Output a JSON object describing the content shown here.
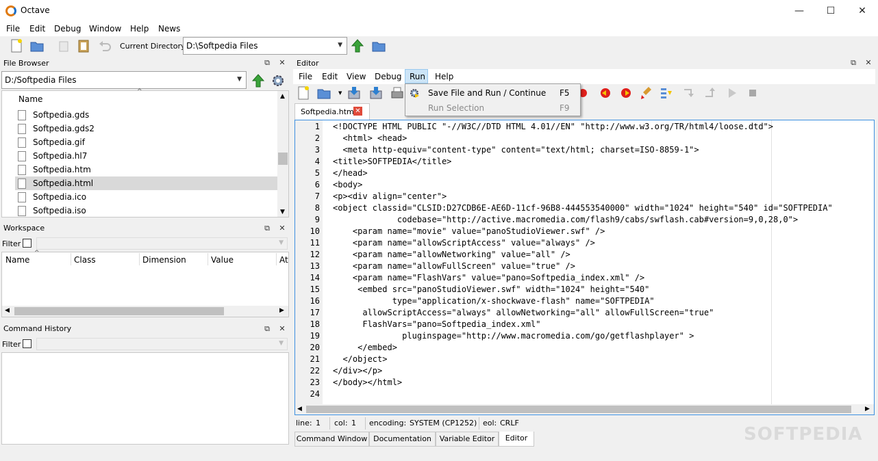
{
  "window": {
    "title": "Octave",
    "minimize": "—",
    "maximize": "☐",
    "close": "✕"
  },
  "menubar": [
    "File",
    "Edit",
    "Debug",
    "Window",
    "Help",
    "News"
  ],
  "toolbar": {
    "current_dir_label": "Current Directory:",
    "current_dir_value": "D:\\Softpedia Files"
  },
  "file_browser": {
    "title": "File Browser",
    "path": "D:/Softpedia Files",
    "column_name": "Name",
    "files": [
      "Softpedia.gds",
      "Softpedia.gds2",
      "Softpedia.gif",
      "Softpedia.hl7",
      "Softpedia.htm",
      "Softpedia.html",
      "Softpedia.ico",
      "Softpedia.iso"
    ],
    "selected_index": 5
  },
  "workspace": {
    "title": "Workspace",
    "filter_label": "Filter",
    "columns": [
      "Name",
      "Class",
      "Dimension",
      "Value",
      "At"
    ]
  },
  "command_history": {
    "title": "Command History",
    "filter_label": "Filter"
  },
  "editor": {
    "title": "Editor",
    "menu": [
      "File",
      "Edit",
      "View",
      "Debug",
      "Run",
      "Help"
    ],
    "active_menu": "Run",
    "run_menu": [
      {
        "label": "Save File and Run / Continue",
        "shortcut": "F5",
        "enabled": true
      },
      {
        "label": "Run Selection",
        "shortcut": "F9",
        "enabled": false
      }
    ],
    "tab": "Softpedia.html",
    "lines": [
      "<!DOCTYPE HTML PUBLIC \"-//W3C//DTD HTML 4.01//EN\" \"http://www.w3.org/TR/html4/loose.dtd\">",
      "  <html> <head>",
      "  <meta http-equiv=\"content-type\" content=\"text/html; charset=ISO-8859-1\">",
      "<title>SOFTPEDIA</title>",
      "</head>",
      "<body>",
      "<p><div align=\"center\">",
      "<object classid=\"CLSID:D27CDB6E-AE6D-11cf-96B8-444553540000\" width=\"1024\" height=\"540\" id=\"SOFTPEDIA\"",
      "             codebase=\"http://active.macromedia.com/flash9/cabs/swflash.cab#version=9,0,28,0\">",
      "    <param name=\"movie\" value=\"panoStudioViewer.swf\" />",
      "    <param name=\"allowScriptAccess\" value=\"always\" />",
      "    <param name=\"allowNetworking\" value=\"all\" />",
      "    <param name=\"allowFullScreen\" value=\"true\" />",
      "    <param name=\"FlashVars\" value=\"pano=Softpedia_index.xml\" />",
      "     <embed src=\"panoStudioViewer.swf\" width=\"1024\" height=\"540\"",
      "            type=\"application/x-shockwave-flash\" name=\"SOFTPEDIA\"",
      "      allowScriptAccess=\"always\" allowNetworking=\"all\" allowFullScreen=\"true\"",
      "      FlashVars=\"pano=Softpedia_index.xml\"",
      "              pluginspage=\"http://www.macromedia.com/go/getflashplayer\" >",
      "     </embed>",
      "  </object>",
      "</div></p>",
      "</body></html>",
      ""
    ]
  },
  "statusbar": {
    "line_label": "line:",
    "line_value": "1",
    "col_label": "col:",
    "col_value": "1",
    "encoding_label": "encoding:",
    "encoding_value": "SYSTEM (CP1252)",
    "eol_label": "eol:",
    "eol_value": "CRLF"
  },
  "bottom_tabs": [
    "Command Window",
    "Documentation",
    "Variable Editor",
    "Editor"
  ],
  "active_bottom_tab": "Editor",
  "watermark": "SOFTPEDIA"
}
